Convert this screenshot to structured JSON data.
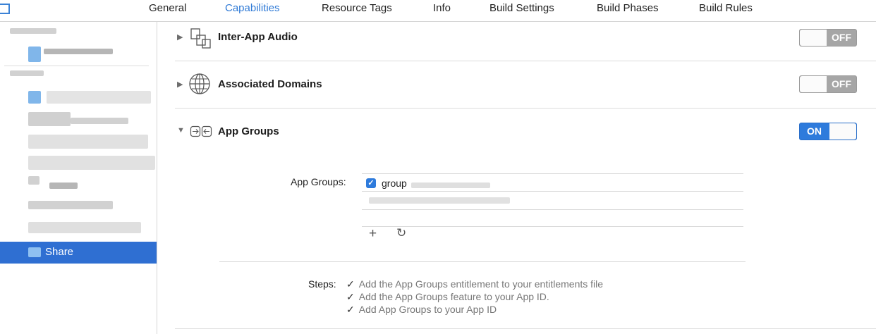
{
  "tabs": [
    {
      "label": "General",
      "active": false
    },
    {
      "label": "Capabilities",
      "active": true
    },
    {
      "label": "Resource Tags",
      "active": false
    },
    {
      "label": "Info",
      "active": false
    },
    {
      "label": "Build Settings",
      "active": false
    },
    {
      "label": "Build Phases",
      "active": false
    },
    {
      "label": "Build Rules",
      "active": false
    }
  ],
  "sidebar": {
    "selected_item": {
      "label": "Share",
      "icon": "extension-target-icon"
    }
  },
  "capabilities": [
    {
      "title": "Inter-App Audio",
      "icon": "inter-app-audio-icon",
      "expanded": false,
      "switch_label": "OFF",
      "enabled": false
    },
    {
      "title": "Associated Domains",
      "icon": "globe-icon",
      "expanded": false,
      "switch_label": "OFF",
      "enabled": false
    },
    {
      "title": "App Groups",
      "icon": "app-groups-icon",
      "expanded": true,
      "switch_label": "ON",
      "enabled": true
    }
  ],
  "app_groups": {
    "field_label": "App Groups:",
    "entries": [
      {
        "checked": true,
        "text": "group"
      }
    ],
    "add_icon": "plus-icon",
    "refresh_icon": "refresh-icon"
  },
  "steps": {
    "label": "Steps:",
    "items": [
      "Add the App Groups entitlement to your entitlements file",
      "Add the App Groups feature to your App ID.",
      "Add App Groups to your App ID"
    ]
  },
  "colors": {
    "accent": "#2f7ad6",
    "selection": "#2f6fd2",
    "switch_on": "#2e7bdc",
    "switch_off": "#a6a6a6"
  }
}
